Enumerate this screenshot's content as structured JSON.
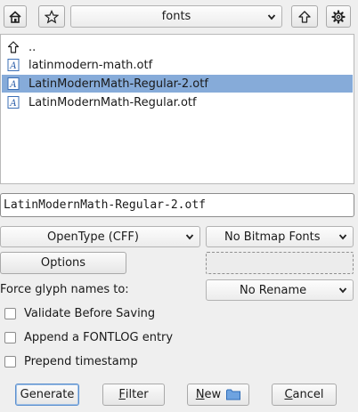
{
  "toolbar": {
    "folder_combo": "fonts",
    "home_icon": "home-icon",
    "bookmark_icon": "star-icon",
    "up_icon": "up-arrow-icon",
    "settings_icon": "gear-icon"
  },
  "file_list": {
    "parent": "..",
    "items": [
      {
        "name": "latinmodern-math.otf",
        "selected": false
      },
      {
        "name": "LatinModernMath-Regular-2.otf",
        "selected": true
      },
      {
        "name": "LatinModernMath-Regular.otf",
        "selected": false
      }
    ]
  },
  "filename_input": {
    "value": "LatinModernMath-Regular-2.otf"
  },
  "format": {
    "outline_combo": "OpenType (CFF)",
    "bitmap_combo": "No Bitmap Fonts"
  },
  "options_button": "Options",
  "glyph_names": {
    "label": "Force glyph names to:",
    "combo": "No Rename"
  },
  "checkboxes": [
    {
      "label": "Validate Before Saving",
      "checked": false
    },
    {
      "label": "Append a FONTLOG entry",
      "checked": false
    },
    {
      "label": "Prepend timestamp",
      "checked": false
    }
  ],
  "buttons": {
    "generate": "Generate",
    "filter_prefix": "",
    "filter_mnemonic": "F",
    "filter_rest": "ilter",
    "new_mnemonic": "N",
    "new_rest": "ew",
    "cancel_mnemonic": "C",
    "cancel_rest": "ancel"
  },
  "colors": {
    "selection": "#86abd9",
    "focus": "#5b8fce"
  }
}
